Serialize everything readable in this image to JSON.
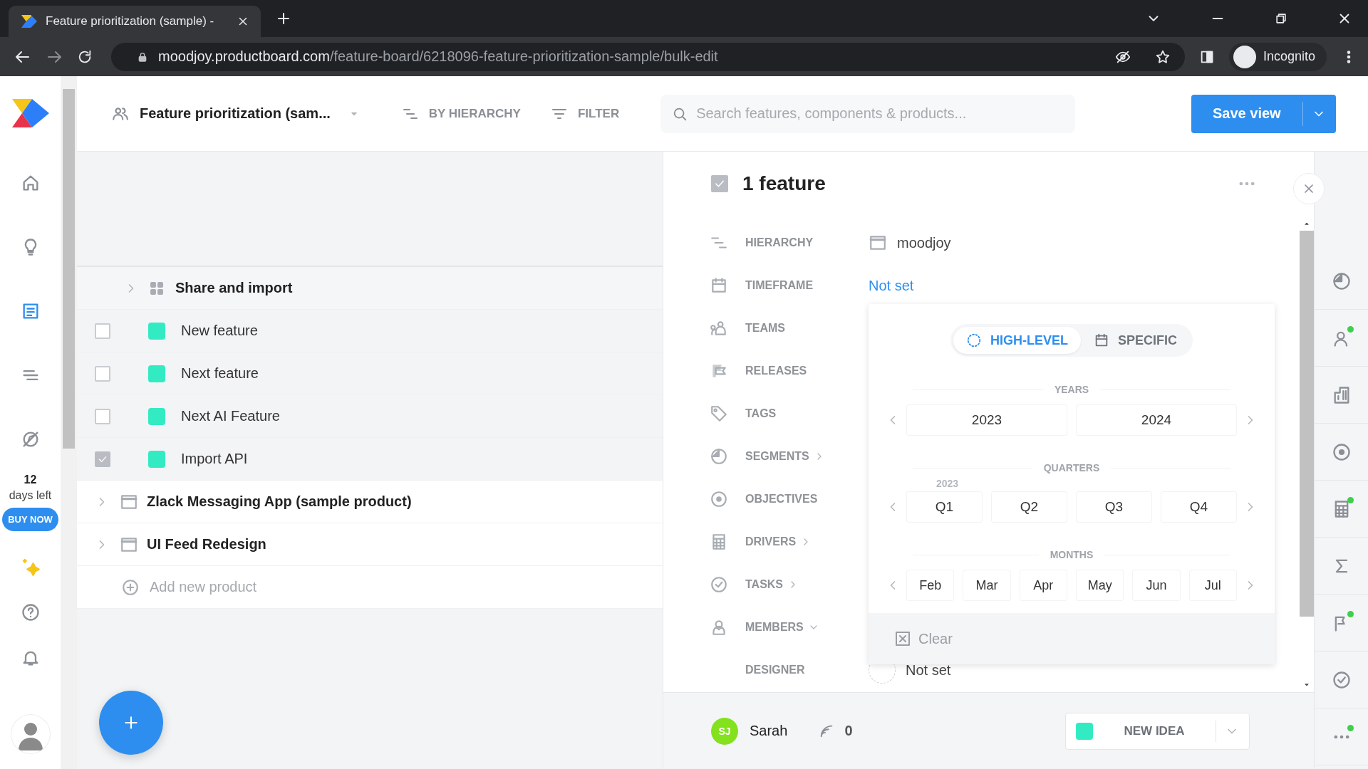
{
  "browser": {
    "tab_title": "Feature prioritization (sample) -",
    "url_host": "moodjoy.productboard.com",
    "url_path": "/feature-board/6218096-feature-prioritization-sample/bulk-edit",
    "profile": "Incognito"
  },
  "rail": {
    "trial_days": "12",
    "trial_label": "days left",
    "buy_label": "BUY NOW",
    "items": [
      {
        "selected": false
      },
      {
        "selected": false
      },
      {
        "selected": true
      },
      {
        "selected": false
      },
      {
        "selected": false
      }
    ]
  },
  "header": {
    "board_title": "Feature prioritization (sam...",
    "grouping": "BY HIERARCHY",
    "filter": "FILTER",
    "search": {
      "placeholder": "Search features, components & products..."
    },
    "save": "Save view"
  },
  "tree": [
    {
      "kind": "group",
      "label": "Share and import",
      "expanded": false
    },
    {
      "kind": "feature",
      "label": "New feature",
      "checked": false
    },
    {
      "kind": "feature",
      "label": "Next feature",
      "checked": false
    },
    {
      "kind": "feature",
      "label": "Next AI Feature",
      "checked": false
    },
    {
      "kind": "feature",
      "label": "Import API",
      "checked": true
    },
    {
      "kind": "product",
      "label": "Zlack Messaging App (sample product)",
      "expanded": false
    },
    {
      "kind": "product",
      "label": "UI Feed Redesign",
      "expanded": false
    },
    {
      "kind": "add",
      "label": "Add new product"
    }
  ],
  "detail": {
    "checked": true,
    "title": "1 feature",
    "properties": [
      {
        "kind": "field",
        "label": "HIERARCHY",
        "value": "moodjoy"
      },
      {
        "kind": "field",
        "label": "TIMEFRAME",
        "link": "Not set"
      },
      {
        "kind": "field",
        "label": "TEAMS"
      },
      {
        "kind": "field",
        "label": "RELEASES"
      },
      {
        "kind": "field",
        "label": "TAGS"
      },
      {
        "kind": "group",
        "label": "SEGMENTS",
        "expanded": false
      },
      {
        "kind": "field",
        "label": "OBJECTIVES"
      },
      {
        "kind": "group",
        "label": "DRIVERS",
        "expanded": false
      },
      {
        "kind": "group",
        "label": "TASKS",
        "expanded": false
      },
      {
        "kind": "group",
        "label": "MEMBERS",
        "expanded": true
      },
      {
        "kind": "subfield",
        "label": "DESIGNER",
        "value": "Not set"
      }
    ],
    "timeframe_popup": {
      "tabs": [
        {
          "label": "HIGH-LEVEL",
          "selected": true
        },
        {
          "label": "SPECIFIC",
          "selected": false
        }
      ],
      "years": {
        "title": "YEARS",
        "items": [
          "2023",
          "2024"
        ]
      },
      "quarters": {
        "title": "QUARTERS",
        "year": "2023",
        "items": [
          "Q1",
          "Q2",
          "Q3",
          "Q4"
        ]
      },
      "months": {
        "title": "MONTHS",
        "items": [
          "Feb",
          "Mar",
          "Apr",
          "May",
          "Jun",
          "Jul"
        ]
      },
      "clear": {
        "label": "Clear",
        "disabled": true
      }
    },
    "footer": {
      "avatar": "SJ",
      "user": "Sarah",
      "count": "0",
      "new_idea": "NEW IDEA"
    }
  }
}
